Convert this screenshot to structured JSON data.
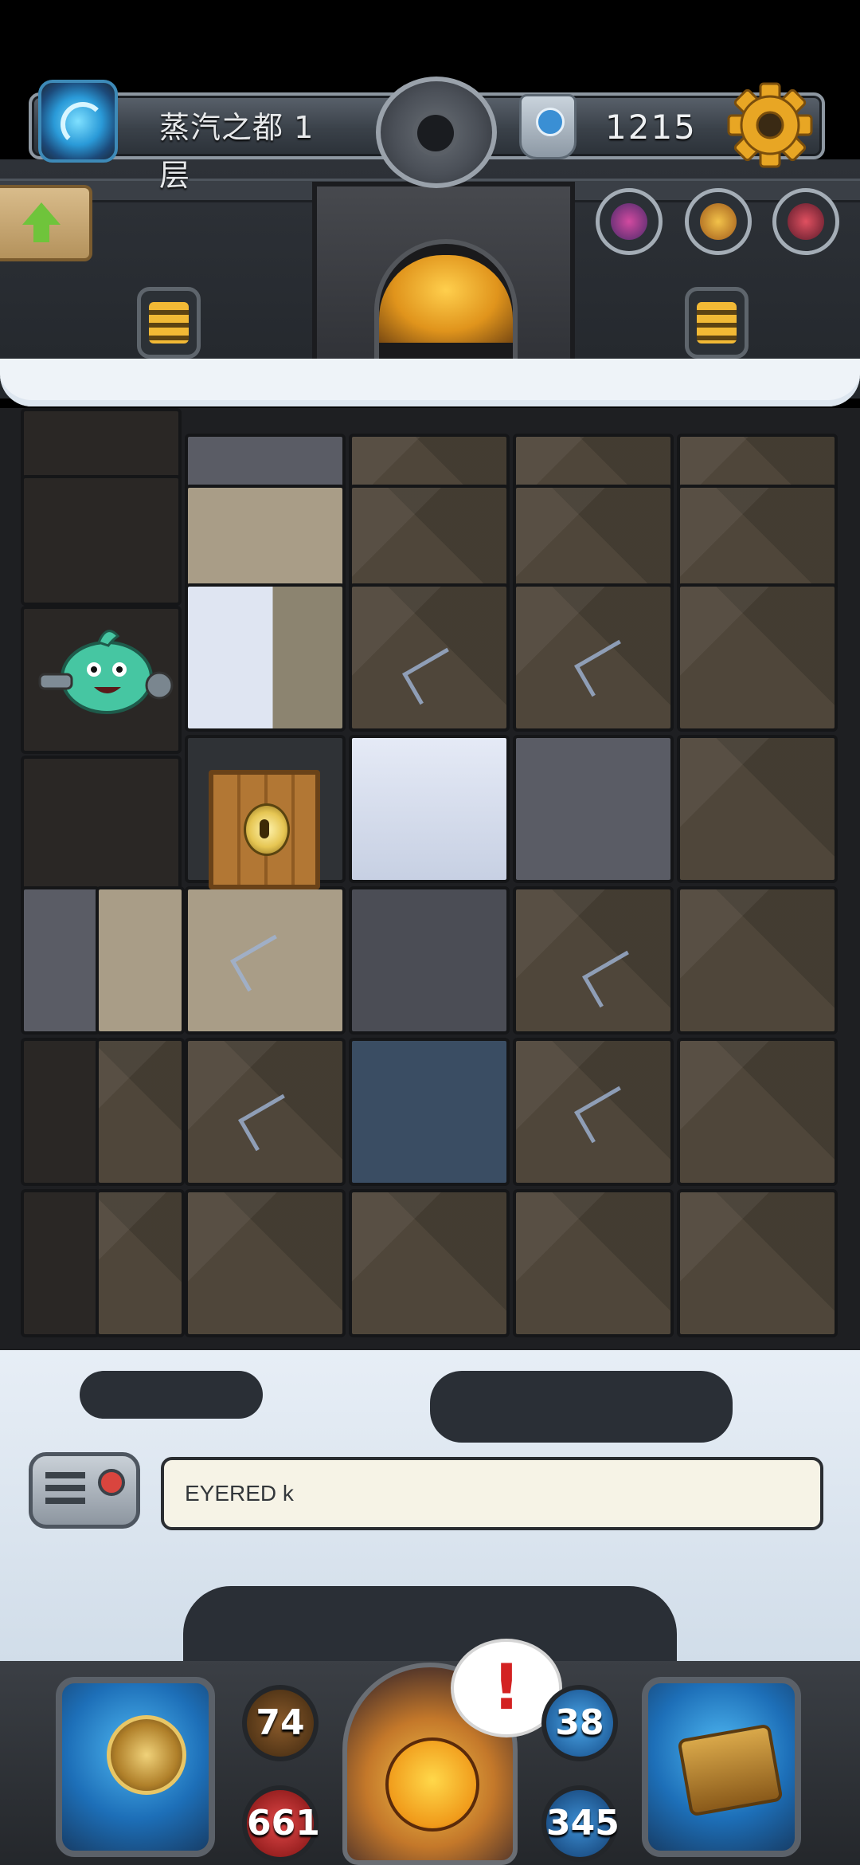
{
  "header": {
    "floor_title": "蒸汽之都 1层",
    "coin_count": "1215"
  },
  "icons": {
    "portal": "portal-icon",
    "bomb": "bomb-dial-icon",
    "key": "key-icon",
    "settings": "gear-icon",
    "back": "up-arrow-icon"
  },
  "chat": {
    "message": "EYERED k"
  },
  "stats": {
    "attack": "74",
    "hp": "661",
    "defense": "38",
    "magic": "345"
  },
  "alert": {
    "symbol": "!"
  },
  "colors": {
    "accent_gold": "#f2b935",
    "hp_red": "#e24848",
    "defense_blue": "#4aa6e8",
    "alert_red": "#d32222"
  }
}
